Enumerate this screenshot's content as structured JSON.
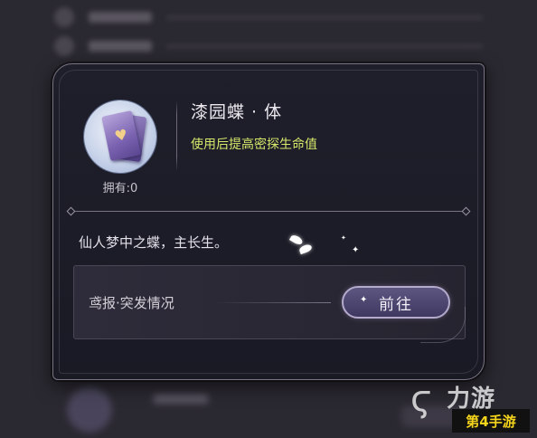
{
  "item": {
    "name": "漆园蝶 · 体",
    "description": "使用后提高密探生命值",
    "owned_label": "拥有:0",
    "icon": "butterfly-card-icon"
  },
  "flavor_text": "仙人梦中之蝶，主长生。",
  "source": {
    "name": "鸢报·突发情况",
    "goto_label": "前往"
  },
  "watermark": {
    "logo_text": "力游",
    "badge_text": "第4手游"
  },
  "colors": {
    "dialog_bg": "#1d1d28",
    "description_accent": "#d6e86a",
    "button_border": "#b4aacc"
  }
}
